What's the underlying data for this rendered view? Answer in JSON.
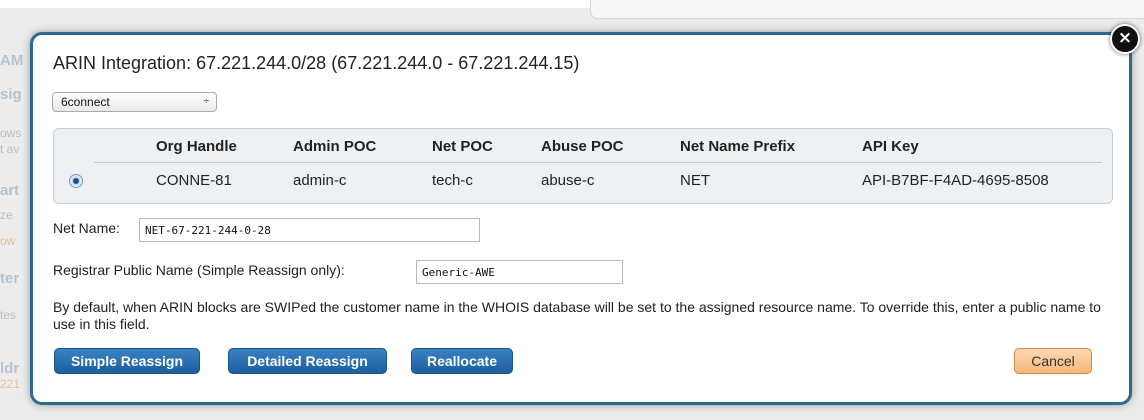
{
  "background": {
    "fragments": [
      "AM",
      "sig",
      "ows",
      "t av",
      "art",
      "ze",
      "ow",
      "ter",
      "tes",
      "ldr",
      "221"
    ]
  },
  "modal": {
    "title": "ARIN Integration: 67.221.244.0/28 (67.221.244.0 - 67.221.244.15)",
    "close_glyph": "×",
    "org_select": {
      "value": "6connect",
      "chevron": "÷"
    },
    "table": {
      "headers": [
        "Org Handle",
        "Admin POC",
        "Net POC",
        "Abuse POC",
        "Net Name Prefix",
        "API Key"
      ],
      "rows": [
        {
          "selected": true,
          "cells": [
            "CONNE-81",
            "admin-c",
            "tech-c",
            "abuse-c",
            "NET",
            "API-B7BF-F4AD-4695-8508"
          ]
        }
      ]
    },
    "net_name": {
      "label": "Net Name:",
      "value": "NET-67-221-244-0-28"
    },
    "registrar": {
      "label": "Registrar Public Name (Simple Reassign only):",
      "value": "Generic-AWE"
    },
    "info_text": "By default, when ARIN blocks are SWIPed the customer name in the WHOIS database will be set to the assigned resource name. To override this, enter a public name to use in this field.",
    "buttons": {
      "simple_reassign": "Simple Reassign",
      "detailed_reassign": "Detailed Reassign",
      "reallocate": "Reallocate",
      "cancel": "Cancel"
    }
  },
  "colors": {
    "modal_border": "#2c6b8c",
    "primary_button": "#2a6fb0",
    "cancel_button": "#f7b67a",
    "table_bg": "#eef1f4"
  }
}
